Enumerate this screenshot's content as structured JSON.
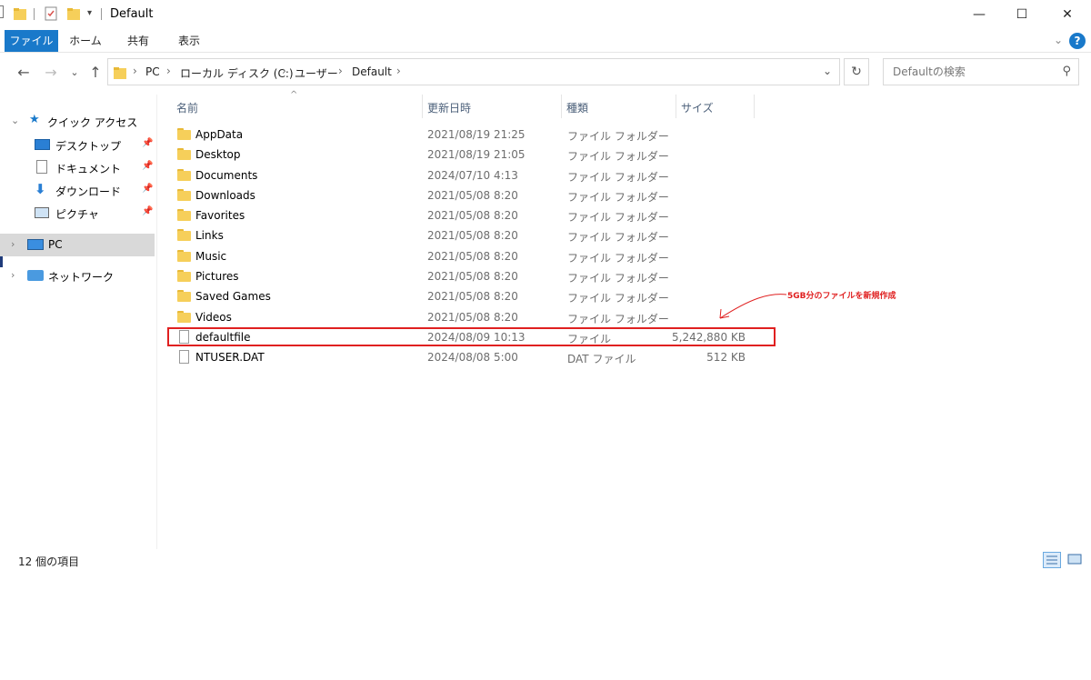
{
  "window": {
    "title": "Default",
    "controls": {
      "minimize": "—",
      "maximize": "☐",
      "close": "✕"
    }
  },
  "ribbon": {
    "tabs": [
      "ファイル",
      "ホーム",
      "共有",
      "表示"
    ],
    "active_tab": "ファイル",
    "help": "?"
  },
  "address": {
    "crumbs": [
      "PC",
      "ローカル ディスク (C:)",
      "ユーザー",
      "Default"
    ],
    "separator": "›"
  },
  "search": {
    "placeholder": "Defaultの検索"
  },
  "nav_pane": {
    "quick_access": "クイック アクセス",
    "quick_items": [
      "デスクトップ",
      "ドキュメント",
      "ダウンロード",
      "ピクチャ"
    ],
    "pc": "PC",
    "network": "ネットワーク"
  },
  "columns": {
    "name": "名前",
    "date": "更新日時",
    "type": "種類",
    "size": "サイズ"
  },
  "files": [
    {
      "name": "AppData",
      "date": "2021/08/19 21:25",
      "type": "ファイル フォルダー",
      "size": "",
      "icon": "folder-icon"
    },
    {
      "name": "Desktop",
      "date": "2021/08/19 21:05",
      "type": "ファイル フォルダー",
      "size": "",
      "icon": "folder-icon"
    },
    {
      "name": "Documents",
      "date": "2024/07/10 4:13",
      "type": "ファイル フォルダー",
      "size": "",
      "icon": "folder-icon"
    },
    {
      "name": "Downloads",
      "date": "2021/05/08 8:20",
      "type": "ファイル フォルダー",
      "size": "",
      "icon": "folder-icon"
    },
    {
      "name": "Favorites",
      "date": "2021/05/08 8:20",
      "type": "ファイル フォルダー",
      "size": "",
      "icon": "folder-icon"
    },
    {
      "name": "Links",
      "date": "2021/05/08 8:20",
      "type": "ファイル フォルダー",
      "size": "",
      "icon": "folder-icon"
    },
    {
      "name": "Music",
      "date": "2021/05/08 8:20",
      "type": "ファイル フォルダー",
      "size": "",
      "icon": "folder-icon"
    },
    {
      "name": "Pictures",
      "date": "2021/05/08 8:20",
      "type": "ファイル フォルダー",
      "size": "",
      "icon": "folder-icon"
    },
    {
      "name": "Saved Games",
      "date": "2021/05/08 8:20",
      "type": "ファイル フォルダー",
      "size": "",
      "icon": "folder-icon"
    },
    {
      "name": "Videos",
      "date": "2021/05/08 8:20",
      "type": "ファイル フォルダー",
      "size": "",
      "icon": "folder-icon"
    },
    {
      "name": "defaultfile",
      "date": "2024/08/09 10:13",
      "type": "ファイル",
      "size": "5,242,880 KB",
      "icon": "file-icon"
    },
    {
      "name": "NTUSER.DAT",
      "date": "2024/08/08 5:00",
      "type": "DAT ファイル",
      "size": "512 KB",
      "icon": "file-icon"
    }
  ],
  "annotation": "5GB分のファイルを新規作成",
  "highlight_color": "#e02020",
  "accent_color": "#1979ca",
  "status": {
    "item_count": "12 個の項目"
  }
}
